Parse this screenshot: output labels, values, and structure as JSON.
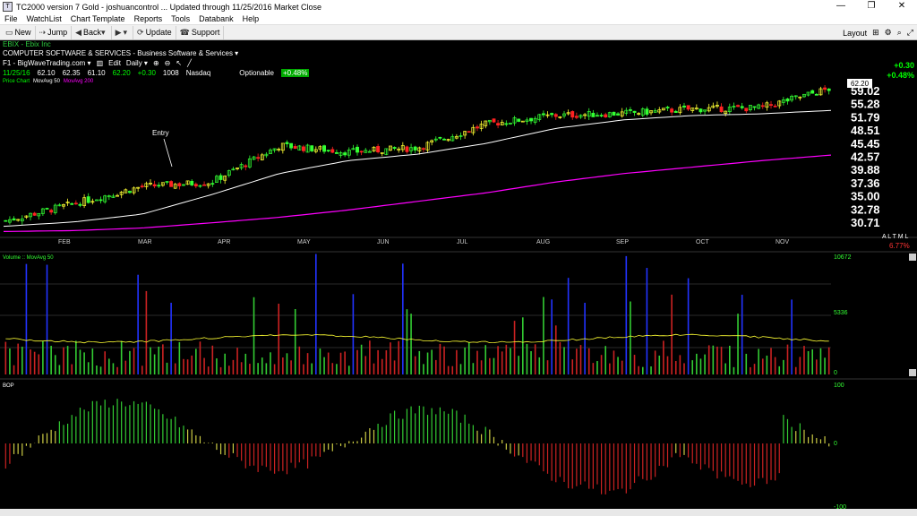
{
  "window": {
    "title": "TC2000 version 7 Gold - joshuancontrol   ... Updated through 11/25/2016  Market Close",
    "minimize": "—",
    "maximize": "❐",
    "close": "✕"
  },
  "menu": [
    "File",
    "WatchList",
    "Chart Template",
    "Reports",
    "Tools",
    "Databank",
    "Help"
  ],
  "toolbar": {
    "new": "New",
    "jump": "Jump",
    "back": "Back",
    "forward_icon": "▶",
    "update": "Update",
    "support": "Support",
    "layout": "Layout"
  },
  "chart_header": {
    "symbol": "EBIX - Ebix Inc",
    "company": "COMPUTER SOFTWARE & SERVICES - Business Software & Services ▾",
    "template": "F1 - BigWaveTrading.com ▾",
    "edit": "Edit",
    "period": "Daily ▾",
    "date": "11/25/16",
    "open": "62.10",
    "high": "62.35",
    "low": "61.10",
    "close": "62.20",
    "change": "+0.30",
    "volume": "1008",
    "exchange": "Nasdaq",
    "optionable": "Optionable",
    "pct_change": "+0.48%",
    "price_chart_label": "Price Chart",
    "ma50_label": "MovAvg 50",
    "ma200_label": "MovAvg 200",
    "right_change": "+0.30",
    "right_pct": "+0.48%"
  },
  "chart_data": [
    {
      "type": "candlestick",
      "name": "Price Chart",
      "annotations": [
        "Entry"
      ],
      "x_labels": [
        "FEB",
        "MAR",
        "APR",
        "MAY",
        "JUN",
        "JUL",
        "AUG",
        "SEP",
        "OCT",
        "NOV"
      ],
      "y_ticks": [
        "59.02",
        "55.28",
        "51.79",
        "48.51",
        "45.45",
        "42.57",
        "39.88",
        "37.36",
        "35.00",
        "32.78",
        "30.71"
      ],
      "last_price": "62.20",
      "scale_flags": "A L  T M L",
      "scale_pct": "6.77%",
      "monthly_close": [
        31.5,
        35.5,
        39.5,
        40.5,
        49.0,
        47.5,
        48.5,
        54.0,
        56.0,
        56.5,
        57.5,
        57.8,
        62.2
      ],
      "ma50": [
        30.2,
        31.2,
        33.0,
        37.5,
        42.5,
        45.5,
        47.0,
        49.5,
        53.0,
        55.0,
        56.0,
        56.4,
        57.2
      ],
      "ma200": [
        29.0,
        29.2,
        29.8,
        31.0,
        32.3,
        34.0,
        36.0,
        38.0,
        40.5,
        42.5,
        44.0,
        45.5,
        46.8
      ]
    },
    {
      "type": "bar",
      "name": "Volume",
      "legend": "Volume :: MovAvg 50",
      "y_ticks": [
        "10672",
        "5336",
        "0"
      ]
    },
    {
      "type": "bar",
      "name": "BOP",
      "legend": "BOP",
      "y_ticks": [
        "100",
        "0",
        "-100"
      ]
    }
  ]
}
